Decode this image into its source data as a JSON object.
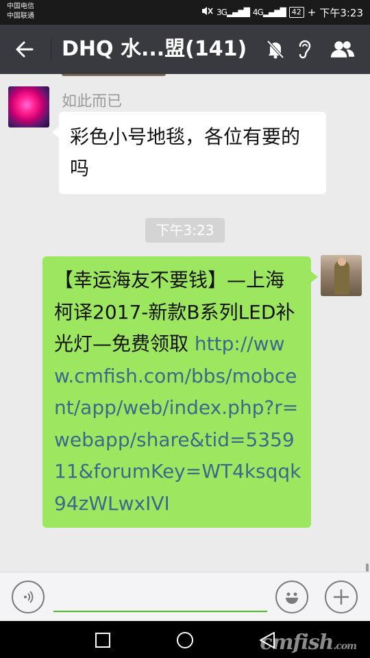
{
  "status_bar": {
    "carrier_1": "中国电信",
    "carrier_2": "中国联通",
    "signal_1": "3G",
    "signal_2": "4G",
    "battery": "42",
    "time": "下午3:23"
  },
  "title_bar": {
    "title": "DHQ 水...盟(141)",
    "icons": [
      "back-arrow-icon",
      "mute-icon",
      "ear-icon",
      "group-members-icon"
    ]
  },
  "chat": {
    "messages": [
      {
        "side": "left",
        "sender": "如此而已",
        "text": "彩色小号地毯，各位有要的吗"
      },
      {
        "timestamp": "下午3:23"
      },
      {
        "side": "right",
        "text_prefix": "【幸运海友不要钱】—上海柯译2017-新款B系列LED补光灯—免费领取 ",
        "link": "http://www.cmfish.com/bbs/mobcent/app/web/index.php?r=webapp/share&tid=535911&forumKey=WT4ksqqk94zWLwxIVI"
      }
    ]
  },
  "input_bar": {
    "placeholder": "",
    "icons": [
      "voice-icon",
      "emoji-icon",
      "plus-icon"
    ]
  },
  "nav_bar": {
    "icons": [
      "recents-icon",
      "home-icon",
      "back-icon"
    ],
    "watermark": "cmfish",
    "watermark_suffix": ".com"
  },
  "colors": {
    "title_bar": "#393a3f",
    "self_bubble": "#9de65f",
    "link": "#3a6a8a",
    "input_underline": "#45c01a"
  }
}
